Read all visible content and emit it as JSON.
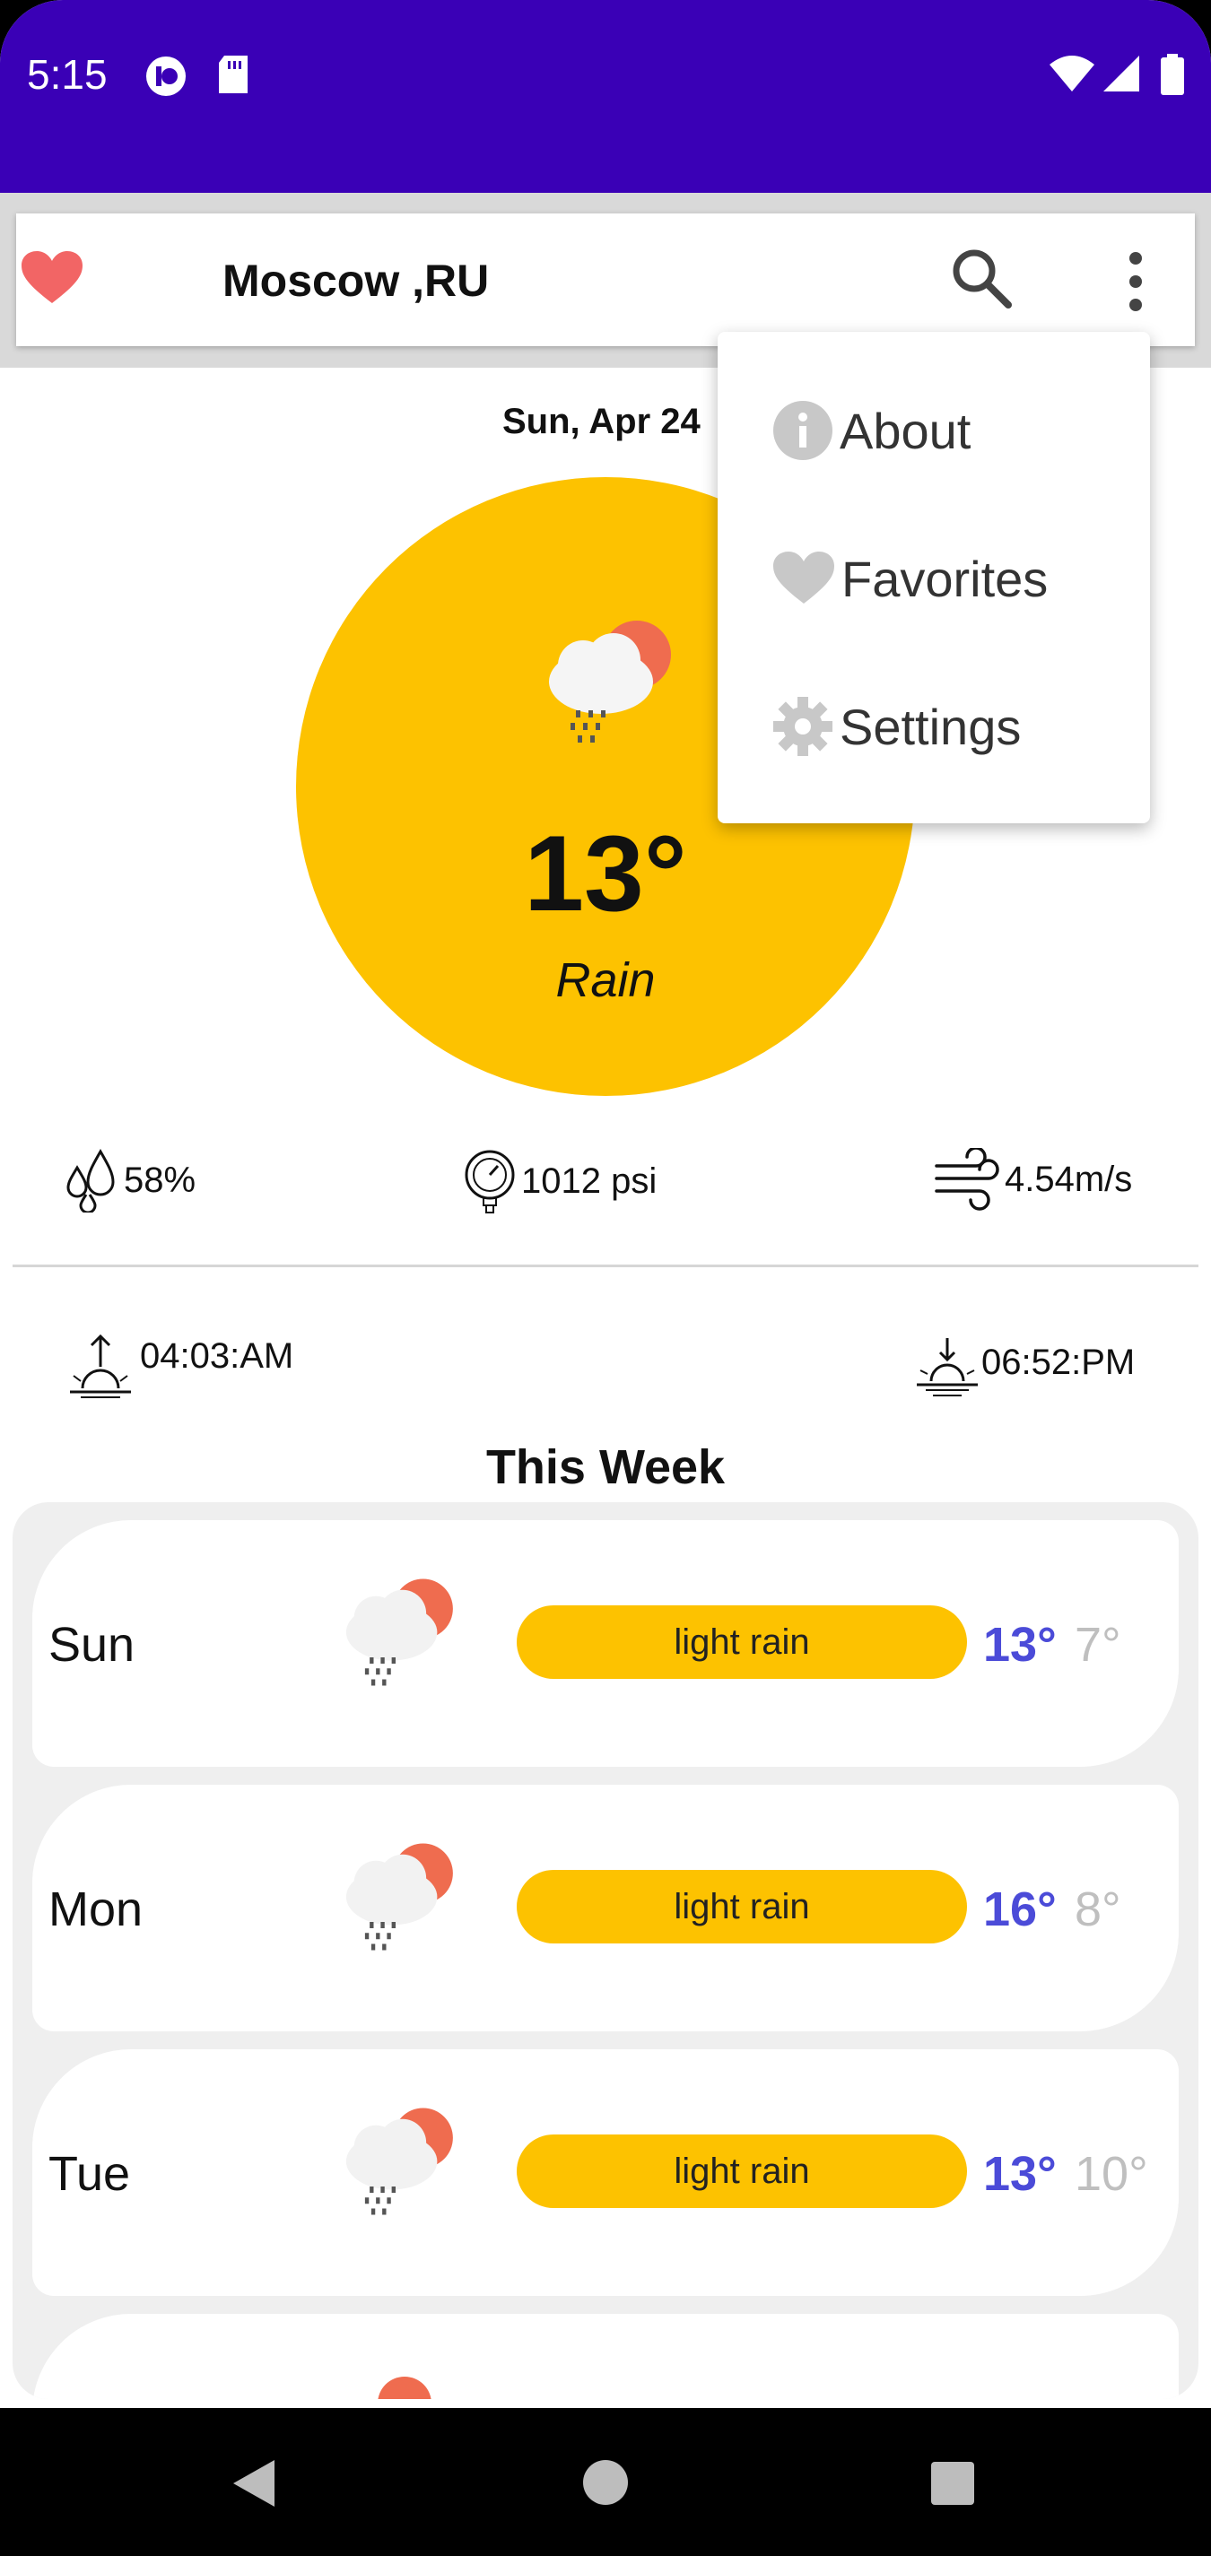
{
  "status_bar": {
    "time": "5:15"
  },
  "app_bar": {
    "city": "Moscow ,RU"
  },
  "current": {
    "date": "Sun, Apr 24",
    "temp": "13°",
    "description": "Rain",
    "humidity": "58%",
    "pressure": "1012 psi",
    "wind": "4.54m/s",
    "sunrise": "04:03:AM",
    "sunset": "06:52:PM"
  },
  "week": {
    "title": "This Week",
    "days": [
      {
        "name": "Sun",
        "description": "light rain",
        "high": "13°",
        "low": "7°"
      },
      {
        "name": "Mon",
        "description": "light rain",
        "high": "16°",
        "low": "8°"
      },
      {
        "name": "Tue",
        "description": "light rain",
        "high": "13°",
        "low": "10°"
      }
    ]
  },
  "menu": {
    "items": [
      {
        "label": "About",
        "icon": "info-icon"
      },
      {
        "label": "Favorites",
        "icon": "heart-icon"
      },
      {
        "label": "Settings",
        "icon": "gear-icon"
      }
    ]
  },
  "colors": {
    "status_bar": "#3a00b6",
    "accent_yellow": "#fdc200",
    "high_temp": "#4b4bd8",
    "low_temp": "#bfbfbf",
    "heart": "#f26565"
  }
}
